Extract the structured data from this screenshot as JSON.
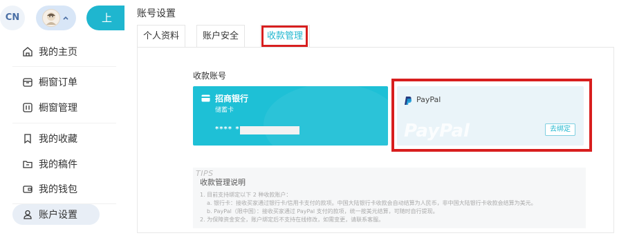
{
  "header": {
    "lang": "CN",
    "upload_label": "上"
  },
  "sidebar": {
    "items": [
      {
        "label": "我的主页",
        "icon": "home-icon"
      },
      {
        "label": "橱窗订单",
        "icon": "order-icon"
      },
      {
        "label": "橱窗管理",
        "icon": "manage-icon"
      },
      {
        "label": "我的收藏",
        "icon": "bookmark-icon"
      },
      {
        "label": "我的稿件",
        "icon": "folder-icon"
      },
      {
        "label": "我的钱包",
        "icon": "wallet-icon"
      },
      {
        "label": "账户设置",
        "icon": "user-icon",
        "active": true
      }
    ]
  },
  "main": {
    "title": "账号设置",
    "tabs": [
      {
        "label": "个人资料"
      },
      {
        "label": "账户安全"
      },
      {
        "label": "收款管理",
        "active": true
      }
    ],
    "section_label": "收款账号",
    "bank_card": {
      "bank_name": "招商银行",
      "card_type": "储蓄卡",
      "card_number": "**** *"
    },
    "paypal_card": {
      "name": "PayPal",
      "watermark": "PayPal",
      "unbind_label": "去绑定"
    },
    "tips": {
      "label": "TIPS",
      "title": "收款管理说明",
      "lines": [
        "1. 目前支持绑定以下 2 种收款账户：",
        "a. 银行卡：接收买家通过银行卡/信用卡支付的款项。中国大陆银行卡收款会自动结算为人民币，非中国大陆银行卡收款会结算为美元。",
        "b. PayPal（限中国）：接收买家通过 PayPal 支付的款项，统一按美元结算，可随时自行提现。",
        "2. 为保障资金安全，账户绑定后不支持在线修改，如需变更，请联系客服。"
      ]
    }
  },
  "colors": {
    "accent": "#1fb6cf",
    "bank_card_bg": "#1ec0d6",
    "highlight_red": "#d81e1e",
    "active_nav_bg": "#e8eef6"
  }
}
